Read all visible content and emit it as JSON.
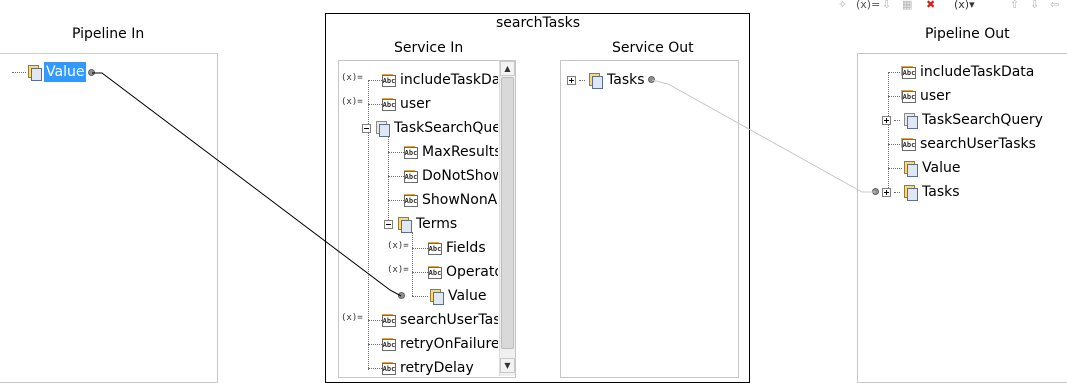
{
  "pipeline_in": {
    "title": "Pipeline In",
    "items": [
      {
        "label": "Value"
      }
    ]
  },
  "service": {
    "title": "searchTasks",
    "service_in": {
      "title": "Service In",
      "items": [
        {
          "label": "includeTaskData"
        },
        {
          "label": "user"
        },
        {
          "label": "TaskSearchQuery"
        },
        {
          "label": "MaxResults"
        },
        {
          "label": "DoNotShow"
        },
        {
          "label": "ShowNonA"
        },
        {
          "label": "Terms"
        },
        {
          "label": "Fields"
        },
        {
          "label": "Operator"
        },
        {
          "label": "Value"
        },
        {
          "label": "searchUserTasks"
        },
        {
          "label": "retryOnFailure"
        },
        {
          "label": "retryDelay"
        }
      ]
    },
    "service_out": {
      "title": "Service Out",
      "items": [
        {
          "label": "Tasks"
        }
      ]
    }
  },
  "pipeline_out": {
    "title": "Pipeline Out",
    "items": [
      {
        "label": "includeTaskData"
      },
      {
        "label": "user"
      },
      {
        "label": "TaskSearchQuery"
      },
      {
        "label": "searchUserTasks"
      },
      {
        "label": "Value"
      },
      {
        "label": "Tasks"
      }
    ]
  },
  "mapping_icon_text": "(x)=",
  "icons": {
    "string": "Abc",
    "document": "document-icon",
    "document_list": "document-list-icon"
  },
  "colors": {
    "selection": "#3399ff",
    "link_line": "#000000",
    "link_line_light": "#c8c8c8"
  }
}
